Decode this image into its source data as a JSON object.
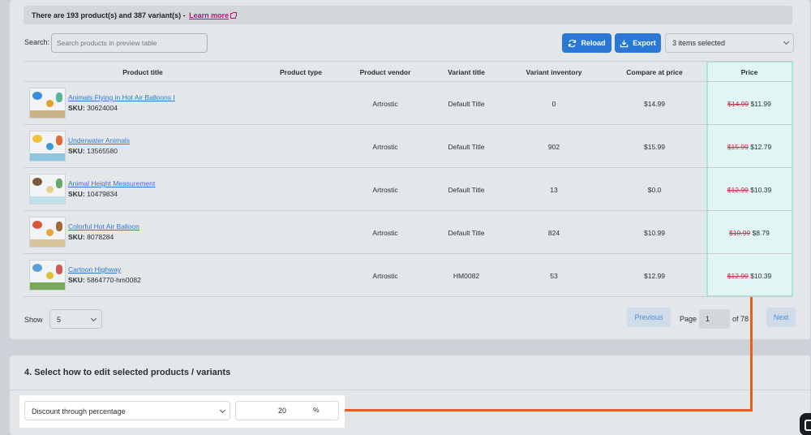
{
  "banner": {
    "text": "There are 193 product(s) and 387 variant(s) - ",
    "learn_more": "Learn more"
  },
  "toolbar": {
    "search_label": "Search:",
    "search_placeholder": "Search products in preview table",
    "reload_label": "Reload",
    "export_label": "Export",
    "selected_label": "3 items selected"
  },
  "table": {
    "headers": [
      "Product title",
      "Product type",
      "Product vendor",
      "Variant title",
      "Variant inventory",
      "Compare at price",
      "Price"
    ],
    "sku_prefix": "SKU:",
    "rows": [
      {
        "title": "Animals Flying in Hot Air Balloons I",
        "sku": "30624004",
        "type": "",
        "vendor": "Artrostic",
        "variant": "Default Title",
        "inventory": "0",
        "compare": "$14.99",
        "price_old": "$14.99",
        "price_new": "$11.99"
      },
      {
        "title": "Underwater Animals",
        "sku": "13565580",
        "type": "",
        "vendor": "Artrostic",
        "variant": "Default Title",
        "inventory": "902",
        "compare": "$15.99",
        "price_old": "$15.99",
        "price_new": "$12.79"
      },
      {
        "title": "Animal Height Measurement",
        "sku": "10479834",
        "type": "",
        "vendor": "Artrostic",
        "variant": "Default Title",
        "inventory": "13",
        "compare": "$0.0",
        "price_old": "$12.99",
        "price_new": "$10.39"
      },
      {
        "title": "Colorful Hot Air Balloon",
        "sku": "8078284",
        "type": "",
        "vendor": "Artrostic",
        "variant": "Default Title",
        "inventory": "824",
        "compare": "$10.99",
        "price_old": "$10.99",
        "price_new": "$8.79"
      },
      {
        "title": "Cartoon Highway",
        "sku": "5864770-hm0082",
        "type": "",
        "vendor": "Artrostic",
        "variant": "HM0082",
        "inventory": "53",
        "compare": "$12.99",
        "price_old": "$12.99",
        "price_new": "$10.39"
      }
    ]
  },
  "pagination": {
    "show_label": "Show",
    "show_value": "5",
    "previous": "Previous",
    "page_label": "Page",
    "page_value": "1",
    "of_label": "of 78",
    "next": "Next"
  },
  "edit": {
    "section_title": "4. Select how to edit selected products / variants",
    "method": "Discount through percentage",
    "value": "20",
    "unit": "%"
  },
  "colors": {
    "accent": "#2b78d4",
    "highlight_line": "#ec5d1c",
    "price_column": "#e0f5f4",
    "strike": "#c0304a"
  }
}
